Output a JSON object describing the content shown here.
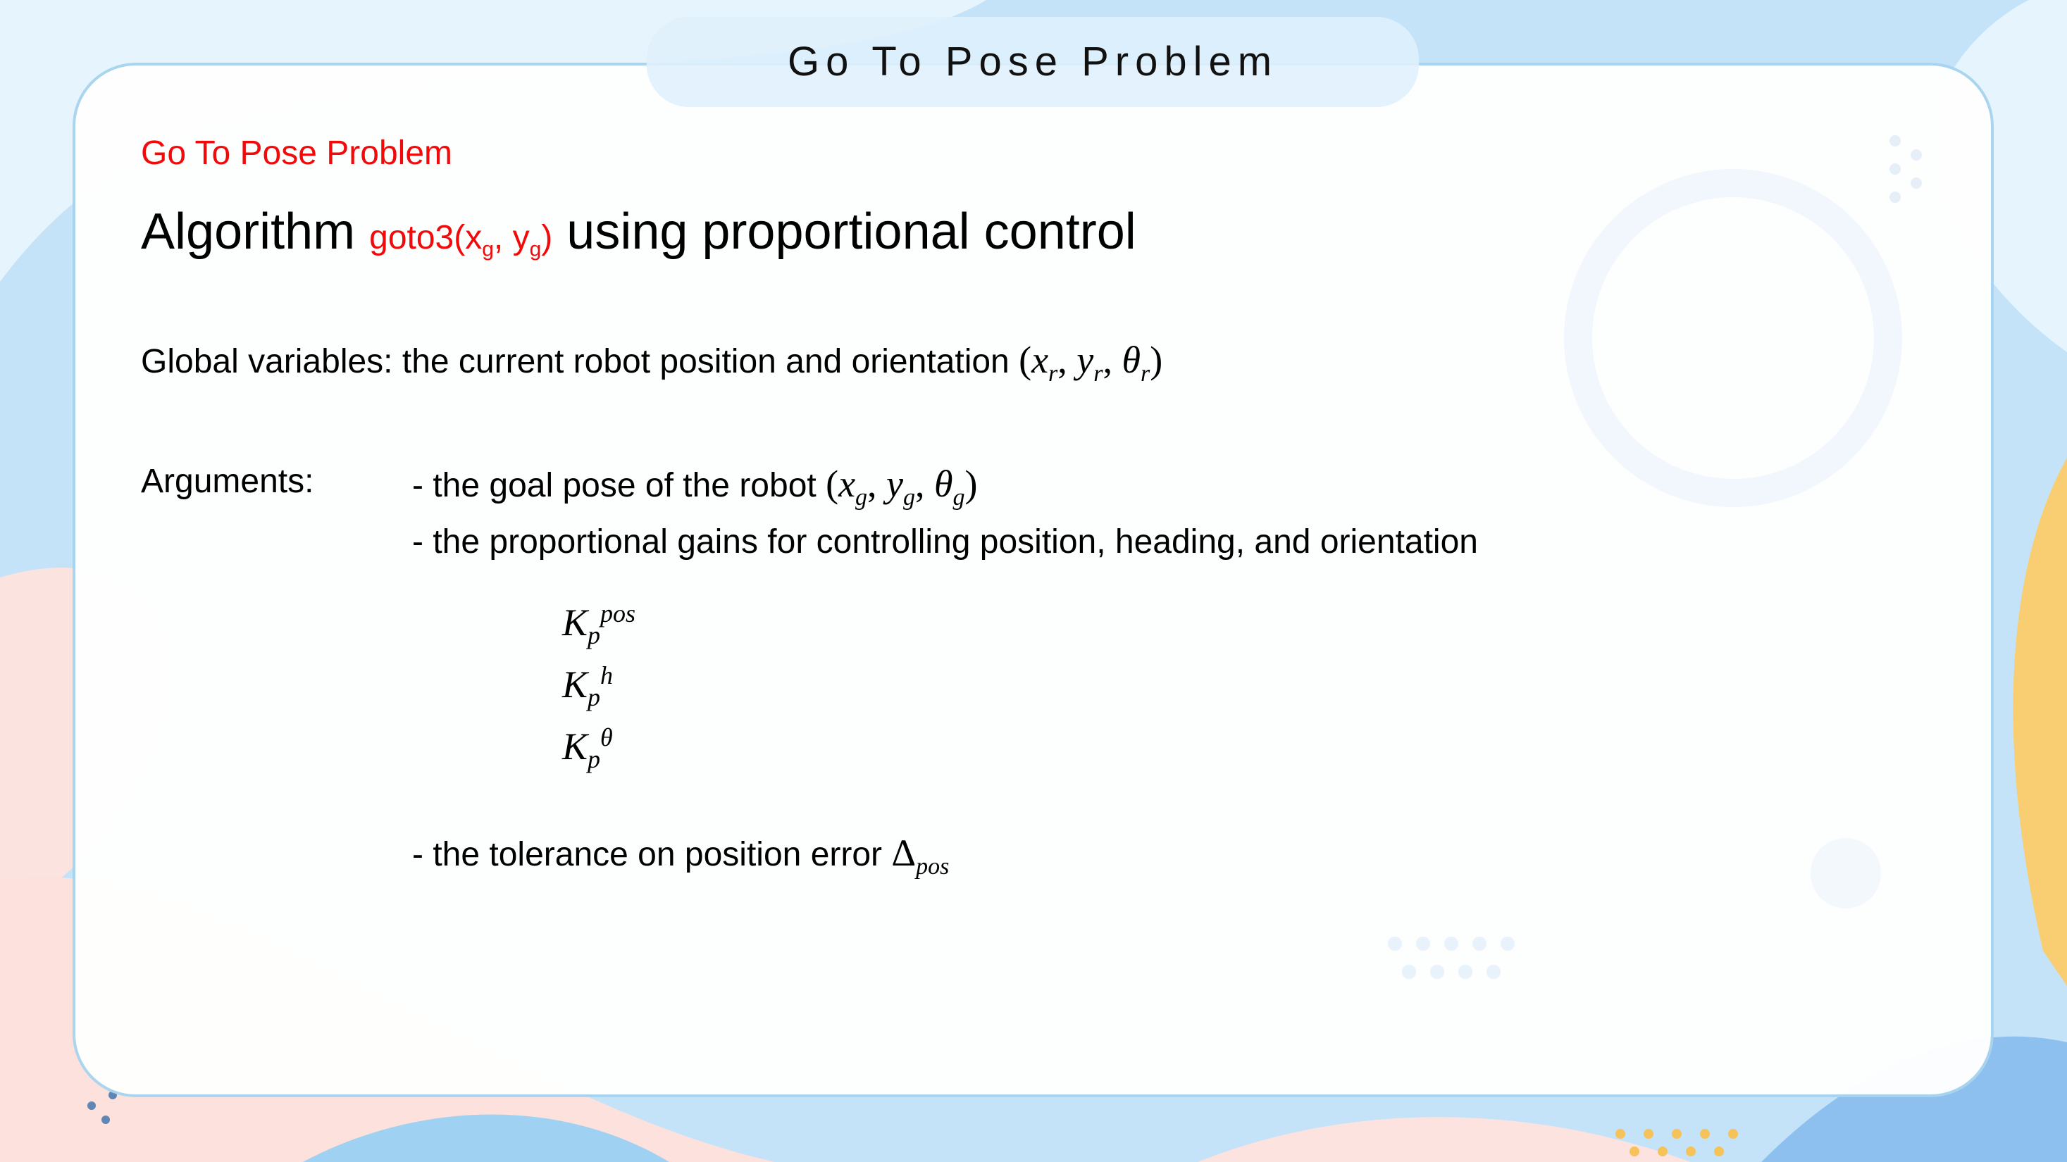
{
  "slide": {
    "title": "Go To Pose Problem",
    "subtitle": "Go To Pose Problem",
    "heading": {
      "prefix": "Algorithm",
      "function_name": "goto3(x",
      "function_sub1": "g",
      "function_mid": ", y",
      "function_sub2": "g",
      "function_close": ")",
      "suffix": "using proportional control"
    },
    "global_vars": {
      "text": "Global variables: the current robot position and orientation",
      "math_open": "(",
      "x": "x",
      "x_sub": "r",
      "y": "y",
      "y_sub": "r",
      "theta": "θ",
      "theta_sub": "r",
      "comma": ",",
      "math_close": ")"
    },
    "arguments": {
      "label": "Arguments:",
      "goal_pose_text": "- the goal pose of the robot",
      "goal_x": "x",
      "goal_x_sub": "g",
      "goal_y": "y",
      "goal_y_sub": "g",
      "goal_theta": "θ",
      "goal_theta_sub": "g",
      "gains_text": "- the proportional gains for controlling position, heading, and orientation",
      "gains": [
        {
          "symbol": "K",
          "sub": "p",
          "sup": "pos"
        },
        {
          "symbol": "K",
          "sub": "p",
          "sup": "h"
        },
        {
          "symbol": "K",
          "sub": "p",
          "sup": "θ"
        }
      ],
      "tolerance_text": "- the tolerance on position error",
      "tolerance_symbol": "Δ",
      "tolerance_sub": "pos"
    }
  },
  "colors": {
    "accent_red": "#f20a0a",
    "background_blue": "#bfe0f6",
    "card_border": "#a9d4ef"
  }
}
